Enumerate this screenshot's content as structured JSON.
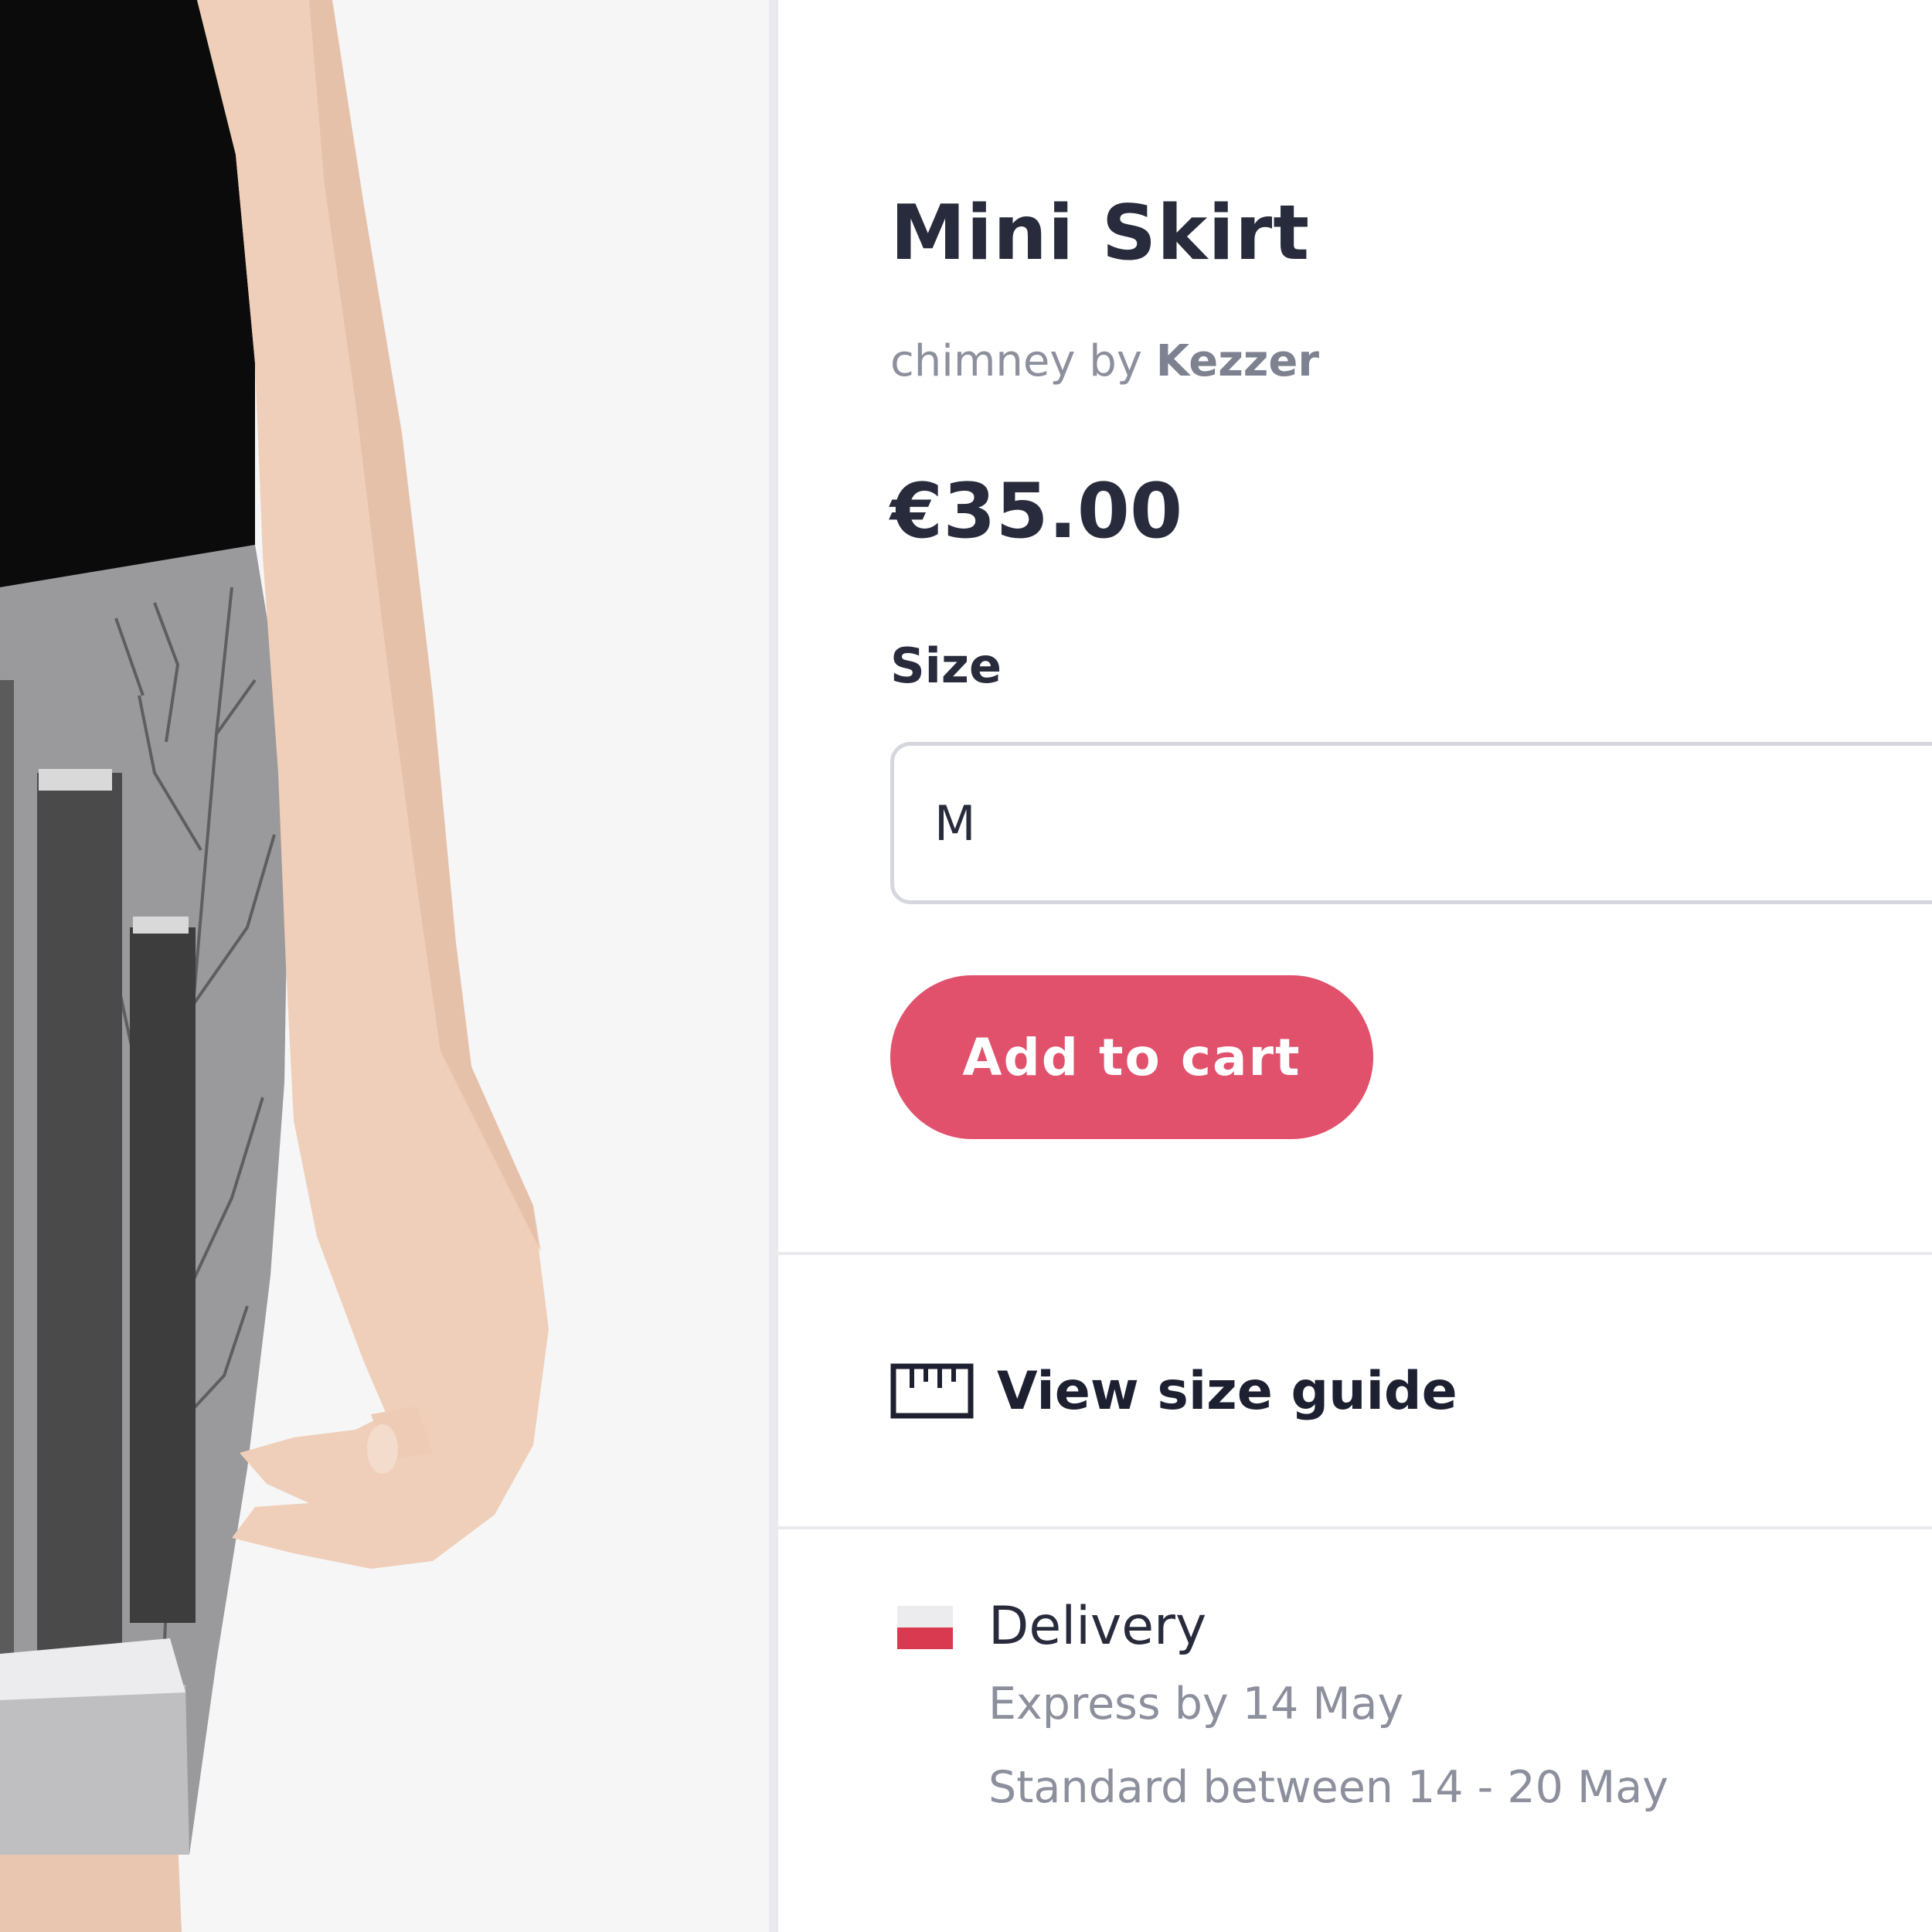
{
  "product": {
    "title": "Mini Skirt",
    "design_name": "chimney",
    "by_word": "by",
    "artist": "Kezzer",
    "price": "€35.00"
  },
  "size": {
    "label": "Size",
    "selected": "M"
  },
  "actions": {
    "add_to_cart_label": "Add to cart",
    "size_guide_label": "View size guide"
  },
  "delivery": {
    "title": "Delivery",
    "express": "Express by 14 May",
    "standard": "Standard between 14 - 20 May",
    "flag_icon": "poland-flag-icon"
  },
  "colors": {
    "accent": "#e1516c",
    "text_dark": "#272b3c",
    "text_muted": "#8c8f9c",
    "divider": "#e9e9ee"
  }
}
